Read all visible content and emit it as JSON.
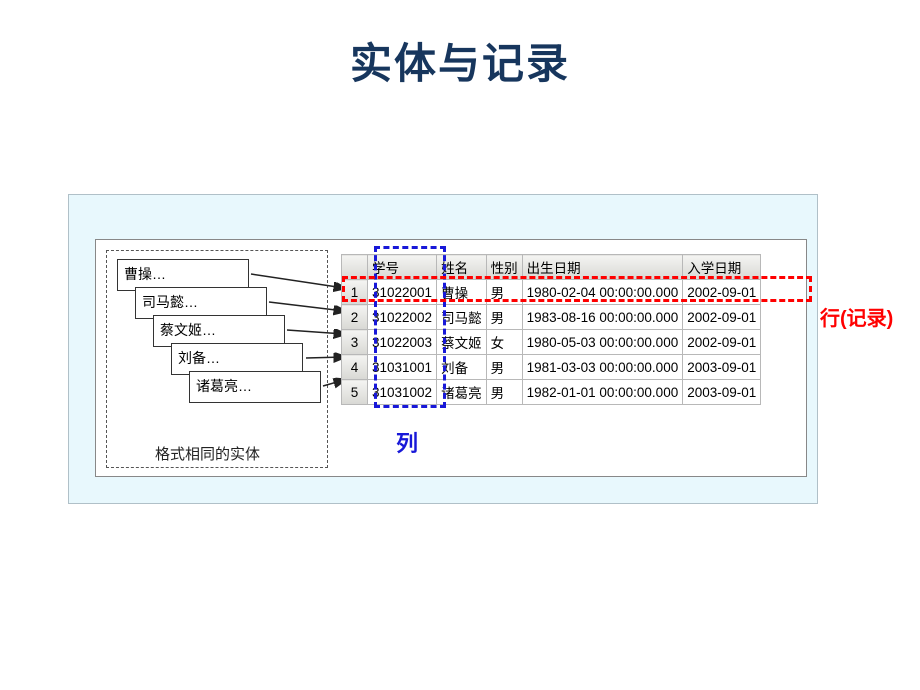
{
  "title": "实体与记录",
  "entities": {
    "cards": [
      "曹操…",
      "司马懿…",
      "蔡文姬…",
      "刘备…",
      "诸葛亮…"
    ],
    "caption": "格式相同的实体"
  },
  "table": {
    "headers": [
      "学号",
      "姓名",
      "性别",
      "出生日期",
      "入学日期"
    ],
    "rows": [
      {
        "num": "1",
        "id": "31022001",
        "name": "曹操",
        "gender": "男",
        "birth": "1980-02-04 00:00:00.000",
        "enroll": "2002-09-01"
      },
      {
        "num": "2",
        "id": "31022002",
        "name": "司马懿",
        "gender": "男",
        "birth": "1983-08-16 00:00:00.000",
        "enroll": "2002-09-01"
      },
      {
        "num": "3",
        "id": "31022003",
        "name": "蔡文姬",
        "gender": "女",
        "birth": "1980-05-03 00:00:00.000",
        "enroll": "2002-09-01"
      },
      {
        "num": "4",
        "id": "31031001",
        "name": "刘备",
        "gender": "男",
        "birth": "1981-03-03 00:00:00.000",
        "enroll": "2003-09-01"
      },
      {
        "num": "5",
        "id": "31031002",
        "name": "诸葛亮",
        "gender": "男",
        "birth": "1982-01-01 00:00:00.000",
        "enroll": "2003-09-01"
      }
    ]
  },
  "labels": {
    "column": "列",
    "row": "行(记录)"
  }
}
